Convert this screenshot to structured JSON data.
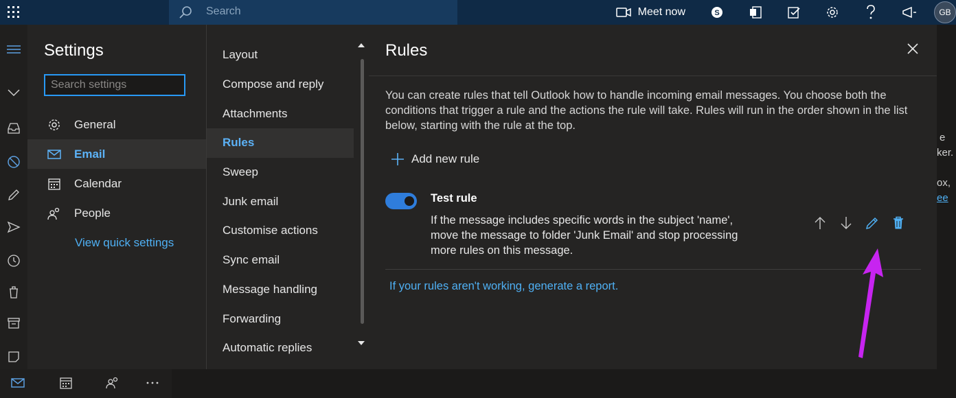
{
  "topbar": {
    "search_placeholder": "Search",
    "meet_now": "Meet now",
    "avatar": "GB"
  },
  "settings": {
    "title": "Settings",
    "search_placeholder": "Search settings",
    "nav": [
      {
        "label": "General",
        "icon": "gear-icon",
        "active": false
      },
      {
        "label": "Email",
        "icon": "mail-icon",
        "active": true
      },
      {
        "label": "Calendar",
        "icon": "calendar-icon",
        "active": false
      },
      {
        "label": "People",
        "icon": "people-icon",
        "active": false
      }
    ],
    "quick_settings": "View quick settings"
  },
  "email_nav": {
    "items": [
      {
        "label": "Layout",
        "active": false
      },
      {
        "label": "Compose and reply",
        "active": false
      },
      {
        "label": "Attachments",
        "active": false
      },
      {
        "label": "Rules",
        "active": true
      },
      {
        "label": "Sweep",
        "active": false
      },
      {
        "label": "Junk email",
        "active": false
      },
      {
        "label": "Customise actions",
        "active": false
      },
      {
        "label": "Sync email",
        "active": false
      },
      {
        "label": "Message handling",
        "active": false
      },
      {
        "label": "Forwarding",
        "active": false
      },
      {
        "label": "Automatic replies",
        "active": false
      }
    ]
  },
  "rules": {
    "title": "Rules",
    "description": "You can create rules that tell Outlook how to handle incoming email messages. You choose both the conditions that trigger a rule and the actions the rule will take. Rules will run in the order shown in the list below, starting with the rule at the top.",
    "add_new": "Add new rule",
    "items": [
      {
        "name": "Test rule",
        "enabled": true,
        "description": "If the message includes specific words in the subject 'name', move the message to folder 'Junk Email' and stop processing more rules on this message."
      }
    ],
    "report_link": "If your rules aren't working, generate a report."
  },
  "right_strip": {
    "fragments": [
      "e",
      "ker.",
      "ox,",
      "ee"
    ]
  },
  "colors": {
    "accent": "#2899f5",
    "link": "#4fb0f4",
    "annotation": "#c724f0"
  }
}
